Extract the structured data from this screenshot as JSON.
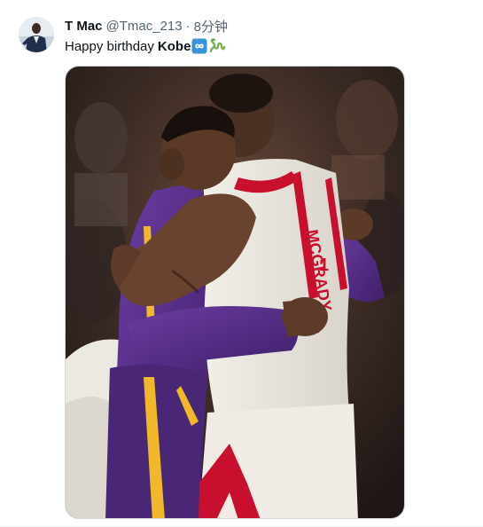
{
  "tweet": {
    "display_name": "T Mac",
    "handle": "@Tmac_213",
    "separator": "·",
    "timestamp": "8分钟",
    "text_prefix": "Happy birthday",
    "text_mention": "Kobe",
    "emojis": [
      "infinity-emoji",
      "snake-emoji"
    ],
    "jersey_lettering": "MCGRADY",
    "jersey_number": "1"
  },
  "colors": {
    "name": "#0f1419",
    "secondary": "#536471",
    "rockets_red": "#c8102e",
    "lakers_purple": "#552583",
    "lakers_gold": "#fdb927",
    "emoji_blue": "#3b94d9",
    "emoji_green": "#77b255"
  }
}
